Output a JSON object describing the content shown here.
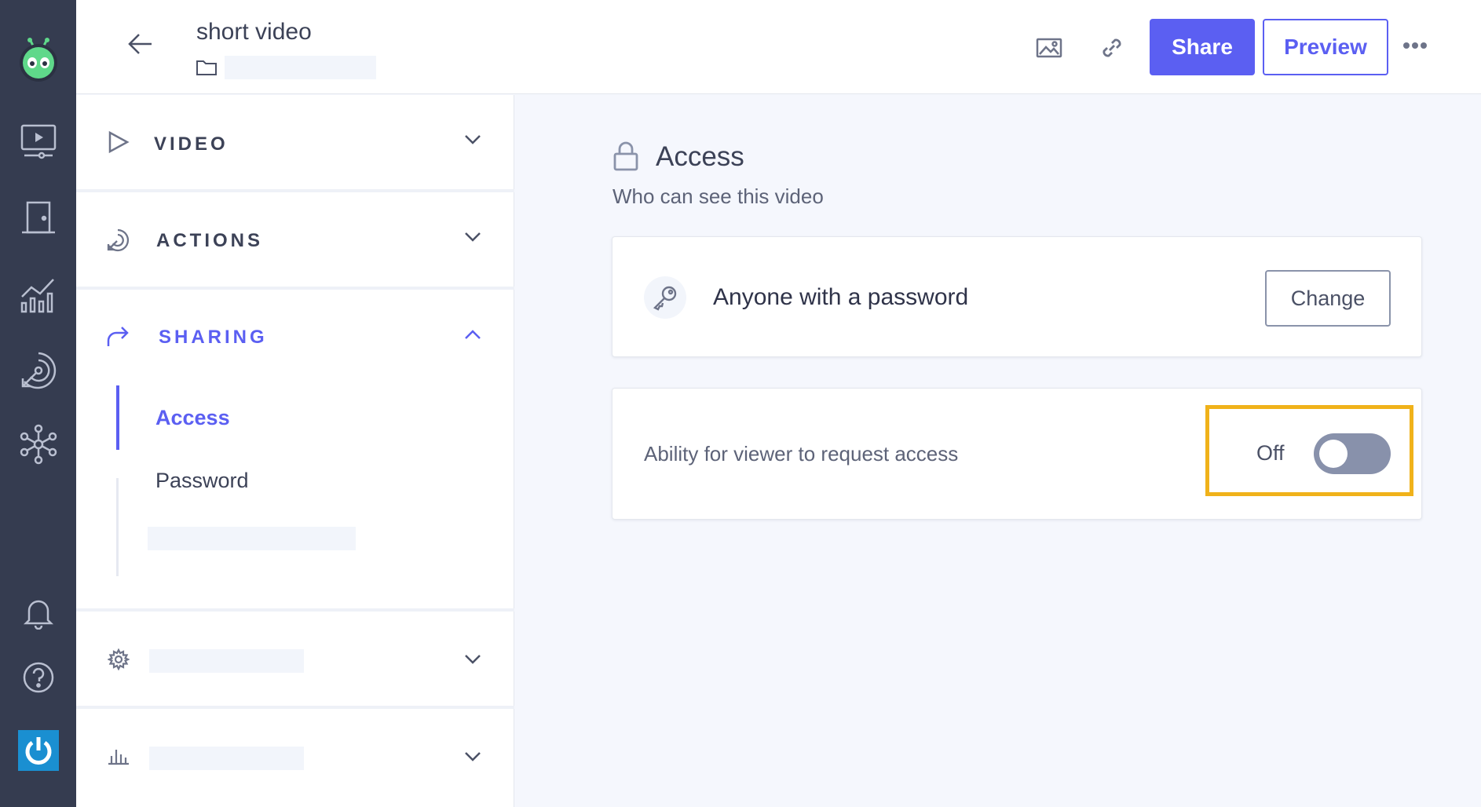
{
  "header": {
    "title": "short video",
    "share_label": "Share",
    "preview_label": "Preview"
  },
  "sidebar": {
    "sections": [
      {
        "label": "VIDEO",
        "icon": "play-icon",
        "expanded": false
      },
      {
        "label": "ACTIONS",
        "icon": "target-arrow-icon",
        "expanded": false
      },
      {
        "label": "SHARING",
        "icon": "share-arrow-icon",
        "expanded": true
      },
      {
        "label": "",
        "icon": "gear-icon",
        "expanded": false
      },
      {
        "label": "",
        "icon": "bar-chart-icon",
        "expanded": false
      }
    ],
    "sharing_items": [
      {
        "label": "Access",
        "active": true
      },
      {
        "label": "Password",
        "active": false
      }
    ]
  },
  "main": {
    "title": "Access",
    "subtitle": "Who can see this video",
    "access_mode": "Anyone with a password",
    "change_label": "Change",
    "request_access_label": "Ability for viewer to request access",
    "request_access_state": "Off"
  },
  "colors": {
    "accent": "#5b5ff2",
    "rail": "#353c50",
    "highlight": "#f0b21a",
    "toggle_off": "#8891ab"
  }
}
